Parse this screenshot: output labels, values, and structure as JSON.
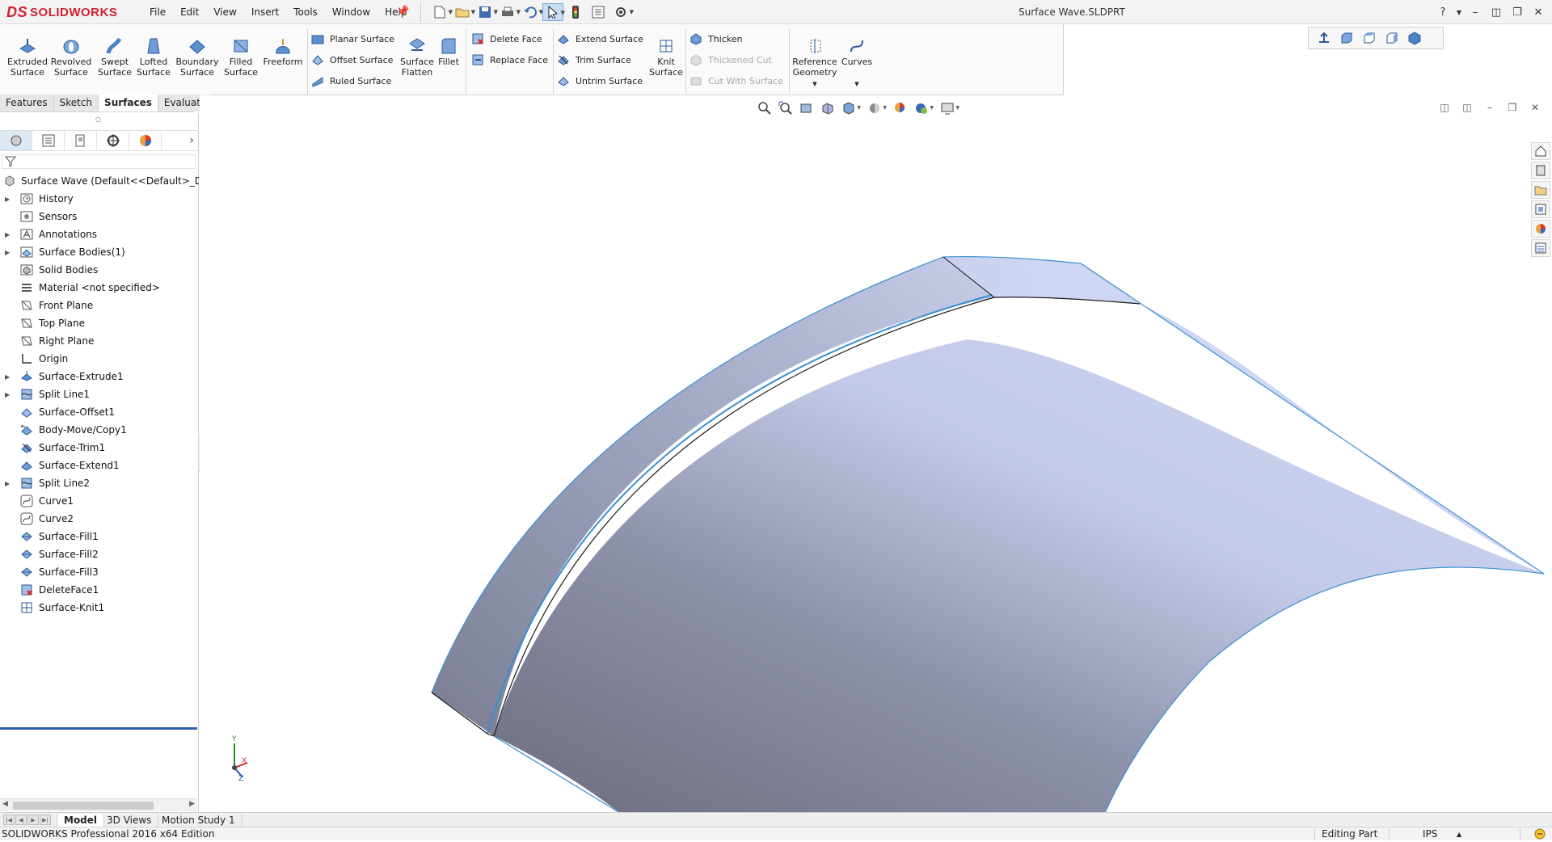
{
  "app": {
    "brand": "SOLIDWORKS",
    "brand_prefix": "DS",
    "document_title": "Surface Wave.SLDPRT"
  },
  "menu": [
    "File",
    "Edit",
    "View",
    "Insert",
    "Tools",
    "Window",
    "Help"
  ],
  "ribbon": {
    "big": [
      {
        "label": "Extruded Surface",
        "icon": "extruded-surface-icon"
      },
      {
        "label": "Revolved Surface",
        "icon": "revolved-surface-icon"
      },
      {
        "label": "Swept Surface",
        "icon": "swept-surface-icon"
      },
      {
        "label": "Lofted Surface",
        "icon": "lofted-surface-icon"
      },
      {
        "label": "Boundary Surface",
        "icon": "boundary-surface-icon"
      },
      {
        "label": "Filled Surface",
        "icon": "filled-surface-icon"
      },
      {
        "label": "Freeform",
        "icon": "freeform-icon"
      }
    ],
    "group1": [
      "Planar Surface",
      "Offset Surface",
      "Ruled Surface"
    ],
    "surface_flatten": "Surface Flatten",
    "fillet": "Fillet",
    "group2": [
      "Delete Face",
      "Replace Face"
    ],
    "group3": [
      "Extend Surface",
      "Trim Surface",
      "Untrim Surface"
    ],
    "knit_surface": "Knit Surface",
    "group4": [
      {
        "label": "Thicken",
        "disabled": false
      },
      {
        "label": "Thickened Cut",
        "disabled": true
      },
      {
        "label": "Cut With Surface",
        "disabled": true
      }
    ],
    "reference_geometry": "Reference Geometry",
    "curves": "Curves"
  },
  "command_tabs": [
    {
      "label": "Features",
      "active": false
    },
    {
      "label": "Sketch",
      "active": false
    },
    {
      "label": "Surfaces",
      "active": true
    },
    {
      "label": "Evaluate",
      "active": false
    }
  ],
  "feature_tree": {
    "root": "Surface Wave  (Default<<Default>_Displa",
    "items": [
      {
        "label": "History",
        "icon": "history-folder-icon",
        "expandable": true
      },
      {
        "label": "Sensors",
        "icon": "sensors-icon",
        "expandable": false
      },
      {
        "label": "Annotations",
        "icon": "annotations-icon",
        "expandable": true
      },
      {
        "label": "Surface Bodies(1)",
        "icon": "surface-bodies-icon",
        "expandable": true
      },
      {
        "label": "Solid Bodies",
        "icon": "solid-bodies-icon",
        "expandable": false
      },
      {
        "label": "Material <not specified>",
        "icon": "material-icon",
        "expandable": false
      },
      {
        "label": "Front Plane",
        "icon": "plane-icon",
        "expandable": false
      },
      {
        "label": "Top Plane",
        "icon": "plane-icon",
        "expandable": false
      },
      {
        "label": "Right Plane",
        "icon": "plane-icon",
        "expandable": false
      },
      {
        "label": "Origin",
        "icon": "origin-icon",
        "expandable": false
      },
      {
        "label": "Surface-Extrude1",
        "icon": "surface-extrude-icon",
        "expandable": true
      },
      {
        "label": "Split Line1",
        "icon": "split-line-icon",
        "expandable": true
      },
      {
        "label": "Surface-Offset1",
        "icon": "surface-offset-icon",
        "expandable": false
      },
      {
        "label": "Body-Move/Copy1",
        "icon": "move-copy-icon",
        "expandable": false
      },
      {
        "label": "Surface-Trim1",
        "icon": "surface-trim-icon",
        "expandable": false
      },
      {
        "label": "Surface-Extend1",
        "icon": "surface-extend-icon",
        "expandable": false
      },
      {
        "label": "Split Line2",
        "icon": "split-line-icon",
        "expandable": true
      },
      {
        "label": "Curve1",
        "icon": "curve-icon",
        "expandable": false
      },
      {
        "label": "Curve2",
        "icon": "curve-icon",
        "expandable": false
      },
      {
        "label": "Surface-Fill1",
        "icon": "surface-fill-icon",
        "expandable": false
      },
      {
        "label": "Surface-Fill2",
        "icon": "surface-fill-icon",
        "expandable": false
      },
      {
        "label": "Surface-Fill3",
        "icon": "surface-fill-icon",
        "expandable": false
      },
      {
        "label": "DeleteFace1",
        "icon": "delete-face-icon",
        "expandable": false
      },
      {
        "label": "Surface-Knit1",
        "icon": "surface-knit-icon",
        "expandable": false
      }
    ]
  },
  "triad": {
    "y": "Y",
    "x": "X",
    "z": "Z"
  },
  "bottom_tabs": [
    {
      "label": "Model",
      "active": true
    },
    {
      "label": "3D Views",
      "active": false
    },
    {
      "label": "Motion Study 1",
      "active": false
    }
  ],
  "status": {
    "edition": "SOLIDWORKS Professional 2016 x64 Edition",
    "mode": "Editing Part",
    "units": "IPS"
  },
  "colors": {
    "accent": "#2e5fa8",
    "brand": "#d1202f",
    "surface_edge": "#3a8fd0"
  }
}
